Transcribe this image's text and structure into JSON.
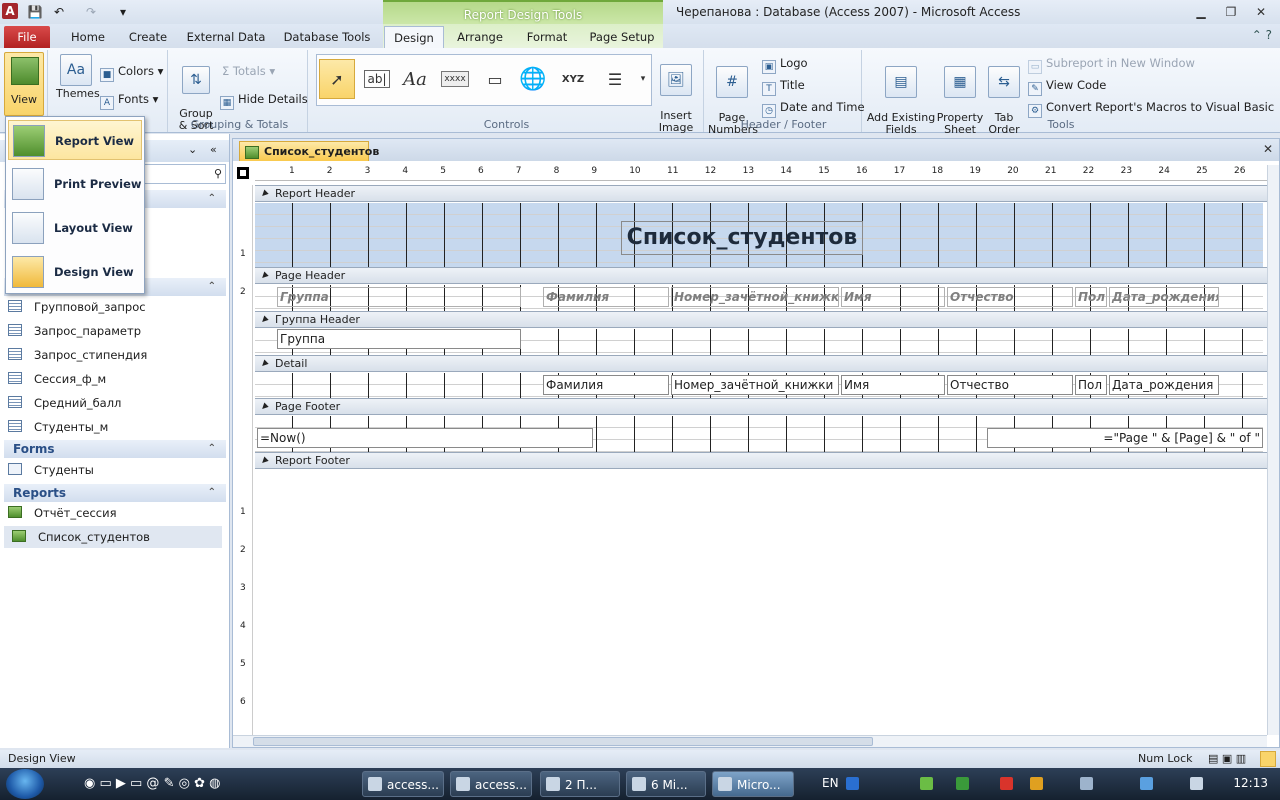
{
  "titlebar": {
    "context_tab_title": "Report Design Tools",
    "window_title": "Черепанова : Database (Access 2007)  -  Microsoft Access"
  },
  "tabs": {
    "file": "File",
    "home": "Home",
    "create": "Create",
    "external": "External Data",
    "dbtools": "Database Tools",
    "design": "Design",
    "arrange": "Arrange",
    "format": "Format",
    "pagesetup": "Page Setup"
  },
  "ribbon": {
    "view": "View",
    "themes": "Themes",
    "colors": "Colors",
    "fonts": "Fonts",
    "group_sort": "Group\n& Sort",
    "totals": "Totals",
    "hide_details": "Hide Details",
    "grouping_label": "Grouping & Totals",
    "controls_label": "Controls",
    "insert_image": "Insert\nImage",
    "page_numbers": "Page\nNumbers",
    "logo": "Logo",
    "title": "Title",
    "date_time": "Date and Time",
    "header_footer_label": "Header / Footer",
    "add_existing": "Add Existing\nFields",
    "property_sheet": "Property\nSheet",
    "tab_order": "Tab\nOrder",
    "subreport_window": "Subreport in New Window",
    "view_code": "View Code",
    "convert_macros": "Convert Report's Macros to Visual Basic",
    "tools_label": "Tools",
    "ctrl_textbox": "ab|",
    "ctrl_label": "Aa",
    "ctrl_button": "xxxx",
    "ctrl_nav": "XYZ"
  },
  "view_menu": {
    "report_view": "Report View",
    "print_preview": "Print Preview",
    "layout_view": "Layout View",
    "design_view": "Design View"
  },
  "nav": {
    "queries": [
      "Групповой_запрос",
      "Запрос_параметр",
      "Запрос_стипендия",
      "Сессия_ф_м",
      "Средний_балл",
      "Студенты_м"
    ],
    "forms_header": "Forms",
    "forms": [
      "Студенты"
    ],
    "reports_header": "Reports",
    "reports": [
      "Отчёт_сессия",
      "Список_студентов"
    ]
  },
  "document": {
    "tab_title": "Список_студентов",
    "ruler_h": [
      "1",
      "2",
      "3",
      "4",
      "5",
      "6",
      "7",
      "8",
      "9",
      "10",
      "11",
      "12",
      "13",
      "14",
      "15",
      "16",
      "17",
      "18",
      "19",
      "20",
      "21",
      "22",
      "23",
      "24",
      "25",
      "26"
    ],
    "ruler_v": [
      "1",
      "2",
      "1",
      "2",
      "3",
      "4",
      "5",
      "6"
    ],
    "bands": {
      "report_header": "Report Header",
      "page_header": "Page Header",
      "group_header": "Группа Header",
      "detail": "Detail",
      "page_footer": "Page Footer",
      "report_footer": "Report Footer"
    },
    "report_title": "Список_студентов",
    "labels": [
      "Группа",
      "Фамилия",
      "Номер_зачётной_книжки",
      "Имя",
      "Отчество",
      "Пол",
      "Дата_рождения"
    ],
    "group_field": "Группа",
    "detail_fields": [
      "Фамилия",
      "Номер_зачётной_книжки",
      "Имя",
      "Отчество",
      "Пол",
      "Дата_рождения"
    ],
    "footer_now": "=Now()",
    "footer_page": "=\"Page \" & [Page] & \" of \""
  },
  "status": {
    "left": "Design View",
    "right": "Num Lock"
  },
  "taskbar": {
    "items": [
      "access...",
      "access...",
      "2 П...",
      "6 Mi...",
      "Micro..."
    ],
    "lang": "EN",
    "clock": "12:13"
  },
  "colors": {
    "file_tab": "#b22222",
    "context_green": "#b6d98a",
    "band_header_fill": "#c6d8ee",
    "doc_tab": "#f9c94e"
  }
}
